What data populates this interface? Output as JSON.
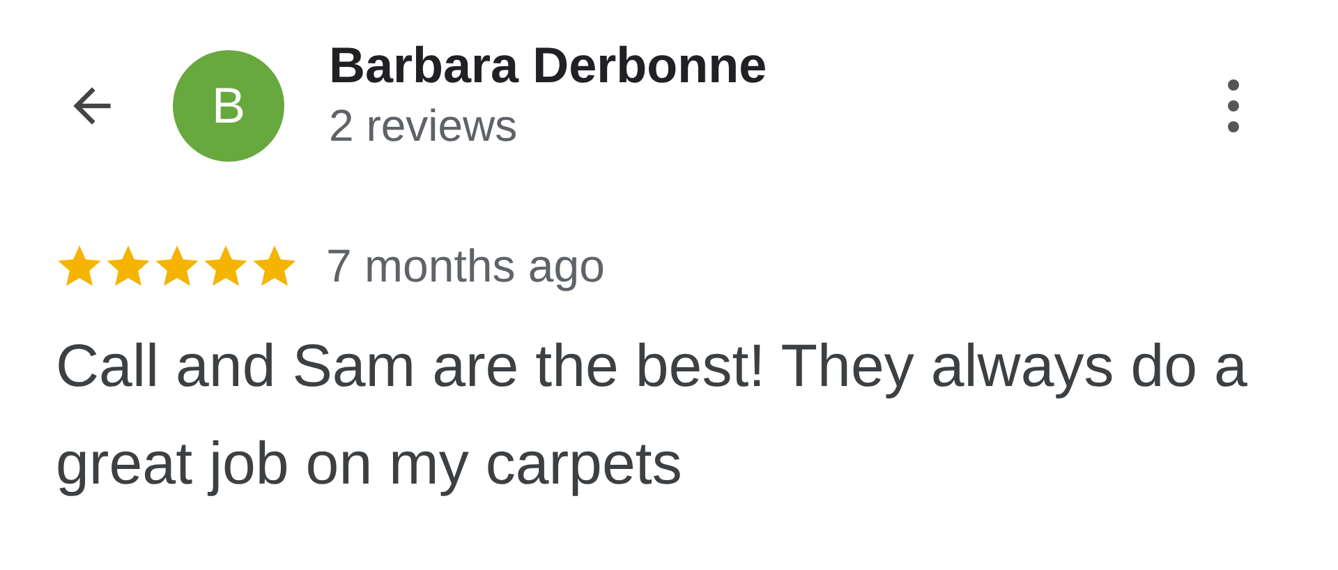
{
  "reviewer": {
    "initial": "B",
    "name": "Barbara Derbonne",
    "reviews": "2 reviews"
  },
  "review": {
    "stars": 5,
    "time": "7 months ago",
    "text": "Call and Sam are the best! They always do a great job on my carpets"
  }
}
